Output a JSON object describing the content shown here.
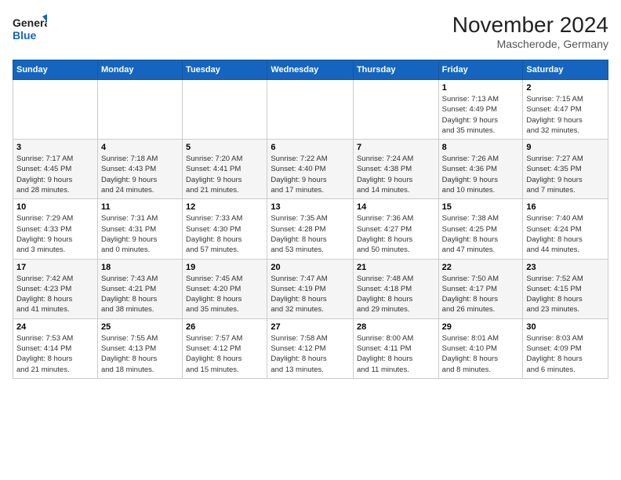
{
  "header": {
    "logo_line1": "General",
    "logo_line2": "Blue",
    "month_title": "November 2024",
    "location": "Mascherode, Germany"
  },
  "days_of_week": [
    "Sunday",
    "Monday",
    "Tuesday",
    "Wednesday",
    "Thursday",
    "Friday",
    "Saturday"
  ],
  "weeks": [
    [
      {
        "day": "",
        "info": ""
      },
      {
        "day": "",
        "info": ""
      },
      {
        "day": "",
        "info": ""
      },
      {
        "day": "",
        "info": ""
      },
      {
        "day": "",
        "info": ""
      },
      {
        "day": "1",
        "info": "Sunrise: 7:13 AM\nSunset: 4:49 PM\nDaylight: 9 hours\nand 35 minutes."
      },
      {
        "day": "2",
        "info": "Sunrise: 7:15 AM\nSunset: 4:47 PM\nDaylight: 9 hours\nand 32 minutes."
      }
    ],
    [
      {
        "day": "3",
        "info": "Sunrise: 7:17 AM\nSunset: 4:45 PM\nDaylight: 9 hours\nand 28 minutes."
      },
      {
        "day": "4",
        "info": "Sunrise: 7:18 AM\nSunset: 4:43 PM\nDaylight: 9 hours\nand 24 minutes."
      },
      {
        "day": "5",
        "info": "Sunrise: 7:20 AM\nSunset: 4:41 PM\nDaylight: 9 hours\nand 21 minutes."
      },
      {
        "day": "6",
        "info": "Sunrise: 7:22 AM\nSunset: 4:40 PM\nDaylight: 9 hours\nand 17 minutes."
      },
      {
        "day": "7",
        "info": "Sunrise: 7:24 AM\nSunset: 4:38 PM\nDaylight: 9 hours\nand 14 minutes."
      },
      {
        "day": "8",
        "info": "Sunrise: 7:26 AM\nSunset: 4:36 PM\nDaylight: 9 hours\nand 10 minutes."
      },
      {
        "day": "9",
        "info": "Sunrise: 7:27 AM\nSunset: 4:35 PM\nDaylight: 9 hours\nand 7 minutes."
      }
    ],
    [
      {
        "day": "10",
        "info": "Sunrise: 7:29 AM\nSunset: 4:33 PM\nDaylight: 9 hours\nand 3 minutes."
      },
      {
        "day": "11",
        "info": "Sunrise: 7:31 AM\nSunset: 4:31 PM\nDaylight: 9 hours\nand 0 minutes."
      },
      {
        "day": "12",
        "info": "Sunrise: 7:33 AM\nSunset: 4:30 PM\nDaylight: 8 hours\nand 57 minutes."
      },
      {
        "day": "13",
        "info": "Sunrise: 7:35 AM\nSunset: 4:28 PM\nDaylight: 8 hours\nand 53 minutes."
      },
      {
        "day": "14",
        "info": "Sunrise: 7:36 AM\nSunset: 4:27 PM\nDaylight: 8 hours\nand 50 minutes."
      },
      {
        "day": "15",
        "info": "Sunrise: 7:38 AM\nSunset: 4:25 PM\nDaylight: 8 hours\nand 47 minutes."
      },
      {
        "day": "16",
        "info": "Sunrise: 7:40 AM\nSunset: 4:24 PM\nDaylight: 8 hours\nand 44 minutes."
      }
    ],
    [
      {
        "day": "17",
        "info": "Sunrise: 7:42 AM\nSunset: 4:23 PM\nDaylight: 8 hours\nand 41 minutes."
      },
      {
        "day": "18",
        "info": "Sunrise: 7:43 AM\nSunset: 4:21 PM\nDaylight: 8 hours\nand 38 minutes."
      },
      {
        "day": "19",
        "info": "Sunrise: 7:45 AM\nSunset: 4:20 PM\nDaylight: 8 hours\nand 35 minutes."
      },
      {
        "day": "20",
        "info": "Sunrise: 7:47 AM\nSunset: 4:19 PM\nDaylight: 8 hours\nand 32 minutes."
      },
      {
        "day": "21",
        "info": "Sunrise: 7:48 AM\nSunset: 4:18 PM\nDaylight: 8 hours\nand 29 minutes."
      },
      {
        "day": "22",
        "info": "Sunrise: 7:50 AM\nSunset: 4:17 PM\nDaylight: 8 hours\nand 26 minutes."
      },
      {
        "day": "23",
        "info": "Sunrise: 7:52 AM\nSunset: 4:15 PM\nDaylight: 8 hours\nand 23 minutes."
      }
    ],
    [
      {
        "day": "24",
        "info": "Sunrise: 7:53 AM\nSunset: 4:14 PM\nDaylight: 8 hours\nand 21 minutes."
      },
      {
        "day": "25",
        "info": "Sunrise: 7:55 AM\nSunset: 4:13 PM\nDaylight: 8 hours\nand 18 minutes."
      },
      {
        "day": "26",
        "info": "Sunrise: 7:57 AM\nSunset: 4:12 PM\nDaylight: 8 hours\nand 15 minutes."
      },
      {
        "day": "27",
        "info": "Sunrise: 7:58 AM\nSunset: 4:12 PM\nDaylight: 8 hours\nand 13 minutes."
      },
      {
        "day": "28",
        "info": "Sunrise: 8:00 AM\nSunset: 4:11 PM\nDaylight: 8 hours\nand 11 minutes."
      },
      {
        "day": "29",
        "info": "Sunrise: 8:01 AM\nSunset: 4:10 PM\nDaylight: 8 hours\nand 8 minutes."
      },
      {
        "day": "30",
        "info": "Sunrise: 8:03 AM\nSunset: 4:09 PM\nDaylight: 8 hours\nand 6 minutes."
      }
    ]
  ]
}
